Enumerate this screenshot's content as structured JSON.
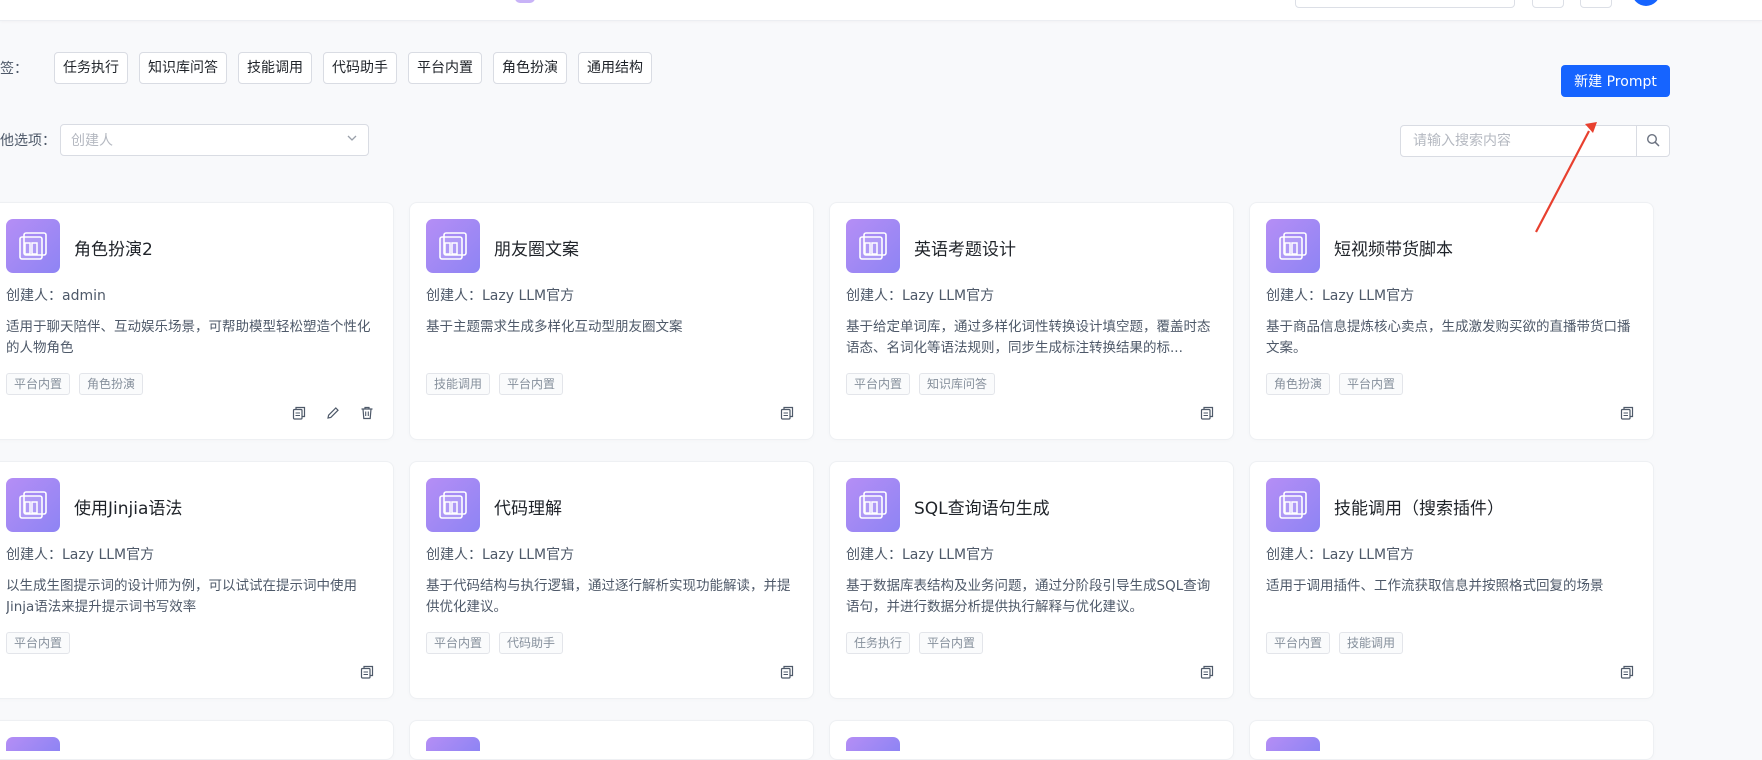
{
  "filter": {
    "tags_label": "签：",
    "tags": [
      "任务执行",
      "知识库问答",
      "技能调用",
      "代码助手",
      "平台内置",
      "角色扮演",
      "通用结构"
    ],
    "other_label": "他选项：",
    "creator_placeholder": "创建人"
  },
  "actions": {
    "new_prompt_label": "新建 Prompt",
    "search_placeholder": "请输入搜索内容"
  },
  "colors": {
    "primary": "#1664ff",
    "icon_gradient_start": "#b58ef5",
    "icon_gradient_end": "#8e84f4",
    "annotation_arrow": "#e8402f"
  },
  "icons": {
    "card_icon": "document-stack-icon",
    "copy": "copy-icon",
    "edit": "edit-pencil-icon",
    "delete": "trash-icon",
    "search": "search-icon",
    "dropdown": "chevron-down-icon"
  },
  "cards": [
    {
      "title": "角色扮演2",
      "creator": "创建人：admin",
      "desc": "适用于聊天陪伴、互动娱乐场景，可帮助模型轻松塑造个性化的人物角色",
      "tags": [
        "平台内置",
        "角色扮演"
      ],
      "editable": true
    },
    {
      "title": "朋友圈文案",
      "creator": "创建人：Lazy LLM官方",
      "desc": "基于主题需求生成多样化互动型朋友圈文案",
      "tags": [
        "技能调用",
        "平台内置"
      ],
      "editable": false
    },
    {
      "title": "英语考题设计",
      "creator": "创建人：Lazy LLM官方",
      "desc": "基于给定单词库，通过多样化词性转换设计填空题，覆盖时态语态、名词化等语法规则，同步生成标注转换结果的标...",
      "tags": [
        "平台内置",
        "知识库问答"
      ],
      "editable": false
    },
    {
      "title": "短视频带货脚本",
      "creator": "创建人：Lazy LLM官方",
      "desc": "基于商品信息提炼核心卖点，生成激发购买欲的直播带货口播文案。",
      "tags": [
        "角色扮演",
        "平台内置"
      ],
      "editable": false
    },
    {
      "title": "使用Jinjia语法",
      "creator": "创建人：Lazy LLM官方",
      "desc": "以生成生图提示词的设计师为例，可以试试在提示词中使用Jinja语法来提升提示词书写效率",
      "tags": [
        "平台内置"
      ],
      "editable": false
    },
    {
      "title": "代码理解",
      "creator": "创建人：Lazy LLM官方",
      "desc": "基于代码结构与执行逻辑，通过逐行解析实现功能解读，并提供优化建议。",
      "tags": [
        "平台内置",
        "代码助手"
      ],
      "editable": false
    },
    {
      "title": "SQL查询语句生成",
      "creator": "创建人：Lazy LLM官方",
      "desc": "基于数据库表结构及业务问题，通过分阶段引导生成SQL查询语句，并进行数据分析提供执行解释与优化建议。",
      "tags": [
        "任务执行",
        "平台内置"
      ],
      "editable": false
    },
    {
      "title": "技能调用（搜索插件）",
      "creator": "创建人：Lazy LLM官方",
      "desc": "适用于调用插件、工作流获取信息并按照格式回复的场景",
      "tags": [
        "平台内置",
        "技能调用"
      ],
      "editable": false
    }
  ]
}
